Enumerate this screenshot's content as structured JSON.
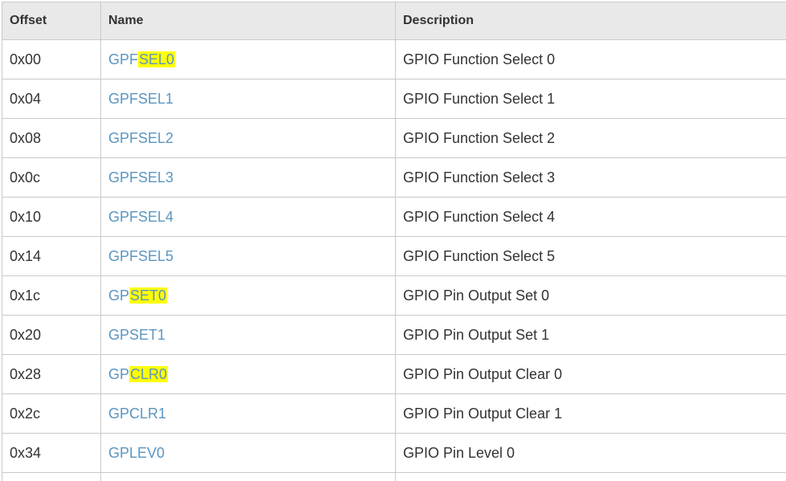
{
  "headers": {
    "offset": "Offset",
    "name": "Name",
    "description": "Description"
  },
  "rows": [
    {
      "offset": "0x00",
      "name_pre": "GPF",
      "name_hl": "SEL0",
      "description": "GPIO Function Select 0"
    },
    {
      "offset": "0x04",
      "name_pre": "GPFSEL1",
      "name_hl": "",
      "description": "GPIO Function Select 1"
    },
    {
      "offset": "0x08",
      "name_pre": "GPFSEL2",
      "name_hl": "",
      "description": "GPIO Function Select 2"
    },
    {
      "offset": "0x0c",
      "name_pre": "GPFSEL3",
      "name_hl": "",
      "description": "GPIO Function Select 3"
    },
    {
      "offset": "0x10",
      "name_pre": "GPFSEL4",
      "name_hl": "",
      "description": "GPIO Function Select 4"
    },
    {
      "offset": "0x14",
      "name_pre": "GPFSEL5",
      "name_hl": "",
      "description": "GPIO Function Select 5"
    },
    {
      "offset": "0x1c",
      "name_pre": "GP",
      "name_hl": "SET0",
      "description": "GPIO Pin Output Set 0"
    },
    {
      "offset": "0x20",
      "name_pre": "GPSET1",
      "name_hl": "",
      "description": "GPIO Pin Output Set 1"
    },
    {
      "offset": "0x28",
      "name_pre": "GP",
      "name_hl": "CLR0",
      "description": "GPIO Pin Output Clear 0"
    },
    {
      "offset": "0x2c",
      "name_pre": "GPCLR1",
      "name_hl": "",
      "description": "GPIO Pin Output Clear 1"
    },
    {
      "offset": "0x34",
      "name_pre": "GPLEV0",
      "name_hl": "",
      "description": "GPIO Pin Level 0"
    }
  ],
  "colors": {
    "link": "#5b95c0",
    "highlight": "#ffff00",
    "header_bg": "#e9e9e9",
    "border": "#c9c9c9"
  }
}
